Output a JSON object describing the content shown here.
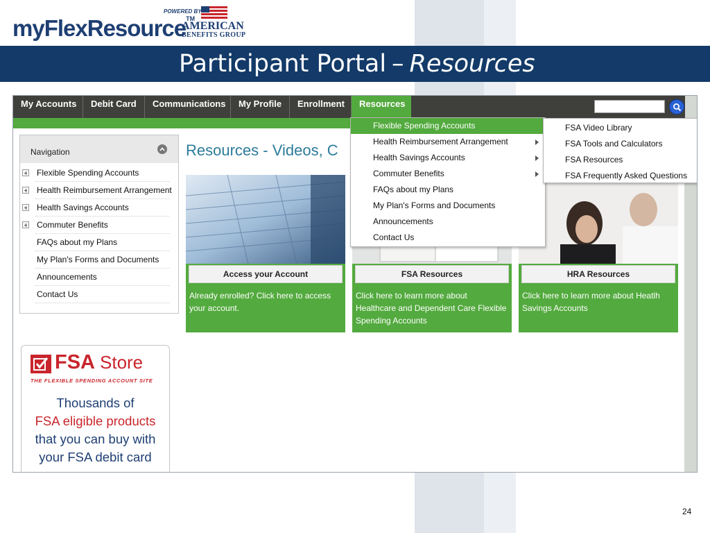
{
  "brand": {
    "name_prefix": "my",
    "name_main": "FlexResource",
    "trademark": "TM",
    "powered_by": "POWERED BY",
    "company_line1": "AMERICAN",
    "company_line2": "BENEFITS GROUP"
  },
  "slide": {
    "title": "Participant Portal",
    "separator": "–",
    "subtitle": "Resources",
    "page_number": "24"
  },
  "nav": {
    "items": [
      "My Accounts",
      "Debit Card",
      "Communications",
      "My Profile",
      "Enrollment",
      "Resources"
    ],
    "active": "Resources",
    "search_value": ""
  },
  "navigation_panel": {
    "title": "Navigation",
    "items": [
      {
        "label": "Flexible Spending Accounts",
        "expandable": true
      },
      {
        "label": "Health Reimbursement Arrangement",
        "expandable": true
      },
      {
        "label": "Health Savings Accounts",
        "expandable": true
      },
      {
        "label": "Commuter Benefits",
        "expandable": true
      },
      {
        "label": "FAQs about my Plans",
        "expandable": false
      },
      {
        "label": "My Plan's Forms and Documents",
        "expandable": false
      },
      {
        "label": "Announcements",
        "expandable": false
      },
      {
        "label": "Contact Us",
        "expandable": false
      }
    ]
  },
  "ad": {
    "logo_bold": "FSA",
    "logo_light": "Store",
    "tagline": "THE FLEXIBLE SPENDING ACCOUNT SITE",
    "line1": "Thousands of",
    "line2": "FSA eligible products",
    "line3": "that you can buy with",
    "line4": "your FSA debit card"
  },
  "main": {
    "heading": "Resources - Videos, C"
  },
  "cards": [
    {
      "button": "Access your Account",
      "description": "Already enrolled? Click here to access your account."
    },
    {
      "button": "FSA Resources",
      "description": "Click here to learn more about Healthcare and Dependent Care Flexible Spending Accounts"
    },
    {
      "button": "HRA Resources",
      "description": "Click here to learn more about Heatlh Savings Accounts"
    }
  ],
  "dropdown": {
    "items": [
      {
        "label": "Flexible Spending Accounts",
        "submenu": true,
        "active": true
      },
      {
        "label": "Health Reimbursement Arrangement",
        "submenu": true,
        "active": false
      },
      {
        "label": "Health Savings Accounts",
        "submenu": true,
        "active": false
      },
      {
        "label": "Commuter Benefits",
        "submenu": true,
        "active": false
      },
      {
        "label": "FAQs about my Plans",
        "submenu": false,
        "active": false
      },
      {
        "label": "My Plan's Forms and Documents",
        "submenu": false,
        "active": false
      },
      {
        "label": "Announcements",
        "submenu": false,
        "active": false
      },
      {
        "label": "Contact Us",
        "submenu": false,
        "active": false
      }
    ],
    "submenu_items": [
      "FSA Video Library",
      "FSA Tools and Calculators",
      "FSA Resources",
      "FSA Frequently Asked Questions"
    ]
  },
  "colors": {
    "header_blue": "#133a68",
    "brand_green": "#53aa3e",
    "nav_dark": "#3f3f3c",
    "heading_teal": "#2c7b9c",
    "fsa_red": "#c9252c"
  }
}
